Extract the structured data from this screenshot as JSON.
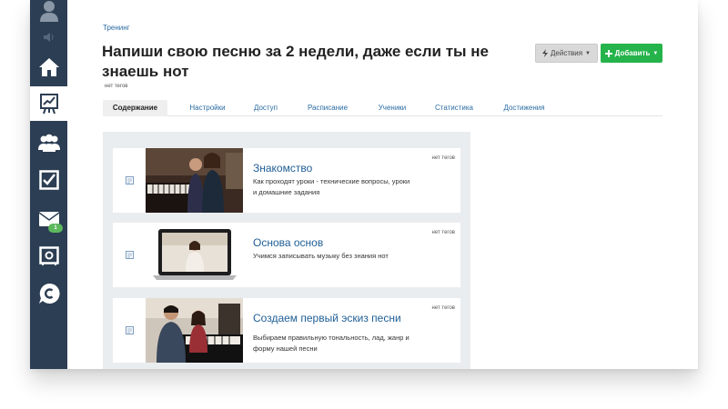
{
  "sidebar": {
    "items": [
      {
        "icon": "user-icon",
        "active": false
      },
      {
        "icon": "speaker-icon",
        "active": false
      },
      {
        "icon": "home-icon",
        "active": false
      },
      {
        "icon": "chart-board-icon",
        "active": true
      },
      {
        "icon": "users-icon",
        "active": false
      },
      {
        "icon": "checkbox-icon",
        "active": false
      },
      {
        "icon": "mail-icon",
        "active": false,
        "badge": "1"
      },
      {
        "icon": "safe-icon",
        "active": false
      },
      {
        "icon": "chat-icon",
        "active": false
      }
    ]
  },
  "header": {
    "breadcrumb": "Тренинг",
    "title": "Напиши свою песню за 2 недели, даже если ты не знаешь нот",
    "tags": "нет тегов",
    "actions_label": "Действия",
    "add_label": "Добавить"
  },
  "tabs": [
    {
      "label": "Содержание",
      "active": true
    },
    {
      "label": "Настройки",
      "active": false
    },
    {
      "label": "Доступ",
      "active": false
    },
    {
      "label": "Расписание",
      "active": false
    },
    {
      "label": "Ученики",
      "active": false
    },
    {
      "label": "Статистика",
      "active": false
    },
    {
      "label": "Достижения",
      "active": false
    }
  ],
  "lessons": [
    {
      "title": "Знакомство",
      "description": "Как проходят уроки - технические вопросы, уроки и домашние задания",
      "tags": "нет тегов",
      "thumb": "piano-duo-photo"
    },
    {
      "title": "Основа основ",
      "description": "Учимся записывать музыку без знания нот",
      "tags": "нет тегов",
      "thumb": "laptop-video-photo"
    },
    {
      "title": "Создаем первый эскиз песни",
      "description": "Выбираем правильную тональность, лад, жанр и форму нашей песни",
      "tags": "нет тегов",
      "thumb": "piano-lesson-photo"
    }
  ],
  "colors": {
    "sidebar": "#2c3e53",
    "link": "#2b6ca3",
    "add_button": "#25b34b",
    "badge": "#5cb85c",
    "content_bg": "#eaedef"
  }
}
